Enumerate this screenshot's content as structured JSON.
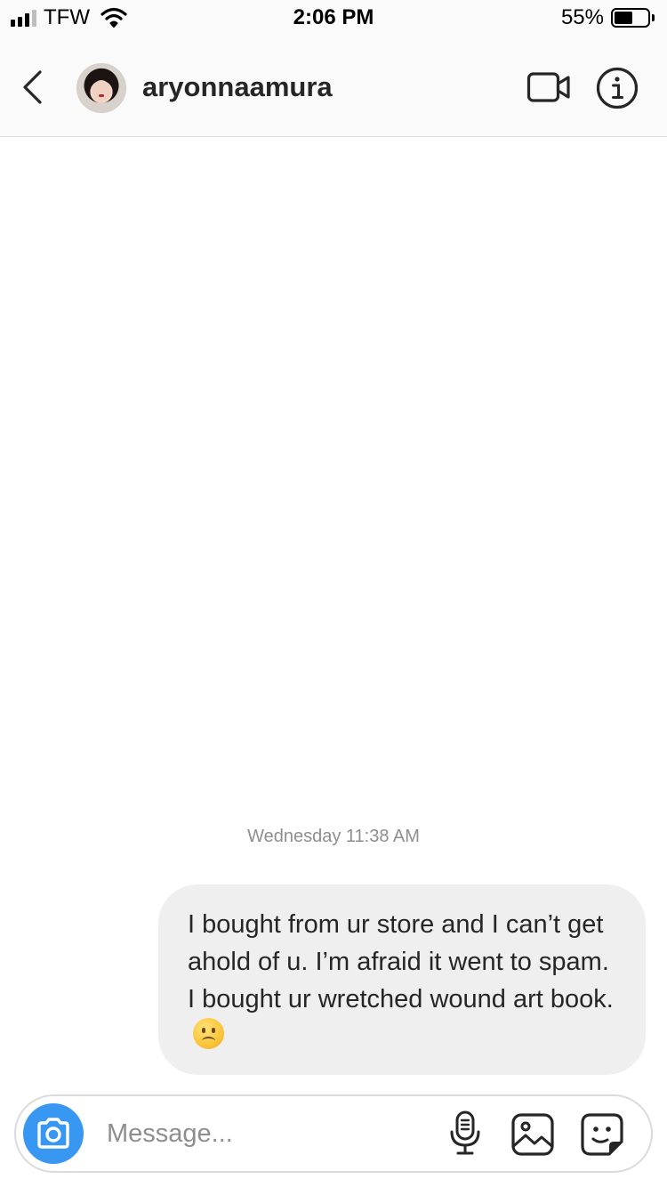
{
  "status_bar": {
    "carrier": "TFW",
    "time": "2:06 PM",
    "battery_percent": "55%",
    "battery_level": 0.55,
    "signal_bars": 3,
    "icons": [
      "signal-icon",
      "wifi-icon",
      "battery-icon"
    ]
  },
  "header": {
    "username": "aryonnaamura",
    "icons": [
      "back-chevron-icon",
      "avatar",
      "video-call-icon",
      "info-icon"
    ]
  },
  "thread": {
    "timestamp": "Wednesday 11:38 AM",
    "messages": [
      {
        "sender": "self",
        "text": "I bought from ur store and I can’t get ahold of u. I’m afraid it went to spam. I bought ur wretched wound art book.",
        "emoji": "frowning-face"
      }
    ]
  },
  "composer": {
    "placeholder": "Message...",
    "value": "",
    "icons": [
      "camera-icon",
      "microphone-icon",
      "gallery-icon",
      "sticker-icon"
    ]
  },
  "colors": {
    "accent": "#3897f0",
    "bubble": "#efefef",
    "text": "#262626",
    "secondary_text": "#8e8e8e",
    "divider": "#dbdbdb",
    "header_bg": "#fafafa"
  }
}
